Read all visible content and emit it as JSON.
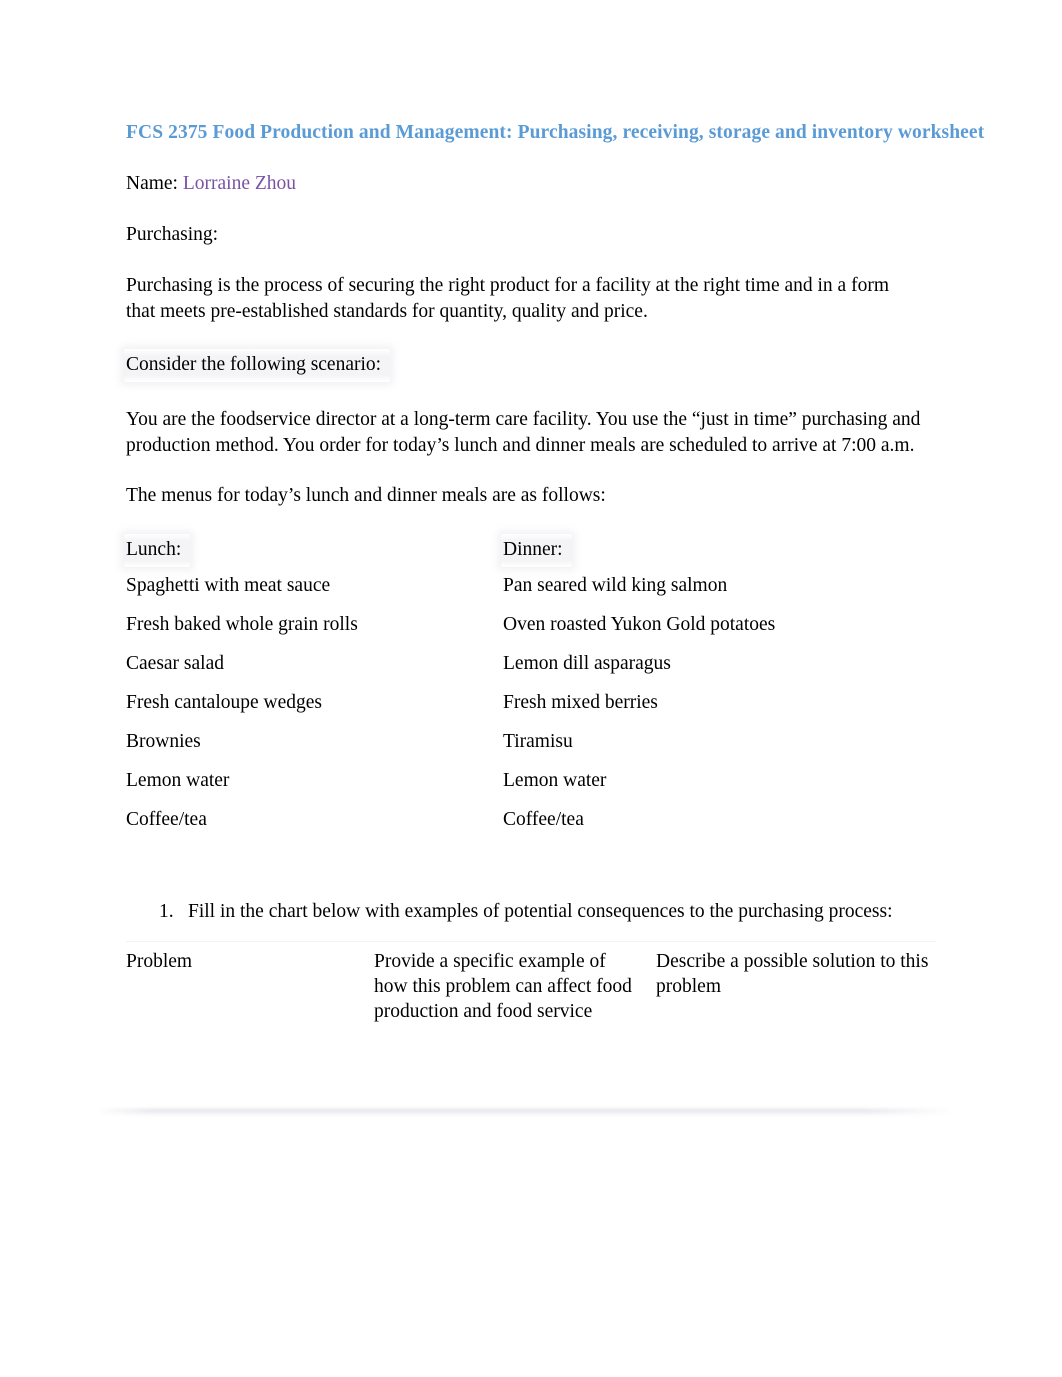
{
  "document": {
    "title": "FCS 2375 Food Production and Management: Purchasing, receiving, storage and inventory worksheet",
    "title_color": "#5b9bd5",
    "name_label": "Name:",
    "name_value": "Lorraine Zhou",
    "name_color": "#7a52a3",
    "section_label": "Purchasing:",
    "definition": "Purchasing is the process of securing the right product for a facility at the right time and in a form that meets pre-established standards for quantity, quality and price.",
    "scenario_heading": "Consider the following scenario:",
    "scenario_body": "You are the foodservice director at a long-term care facility. You use the “just in time” purchasing and production method. You order for today’s lunch and dinner meals are scheduled to arrive at 7:00 a.m.",
    "menus_intro": "The menus for today’s lunch and dinner meals are as follows:"
  },
  "menus": {
    "lunch_heading": "Lunch:",
    "dinner_heading": "Dinner:",
    "rows": [
      {
        "lunch": "Spaghetti with meat sauce",
        "dinner": "Pan seared wild king salmon"
      },
      {
        "lunch": "Fresh baked whole grain rolls",
        "dinner": "Oven roasted Yukon Gold potatoes"
      },
      {
        "lunch": "Caesar salad",
        "dinner": "Lemon dill asparagus"
      },
      {
        "lunch": "Fresh cantaloupe wedges",
        "dinner": "Fresh mixed berries"
      },
      {
        "lunch": "Brownies",
        "dinner": "Tiramisu"
      },
      {
        "lunch": "Lemon water",
        "dinner": "Lemon water"
      },
      {
        "lunch": "Coffee/tea",
        "dinner": "Coffee/tea"
      }
    ]
  },
  "question": {
    "number": "1.",
    "text": "Fill in the chart below with examples of potential consequences to the purchasing process:"
  },
  "chart_table": {
    "headers": [
      "Problem",
      "Provide a specific example of how this problem can affect food production and food service",
      "Describe a possible solution to this problem"
    ],
    "rows": []
  }
}
